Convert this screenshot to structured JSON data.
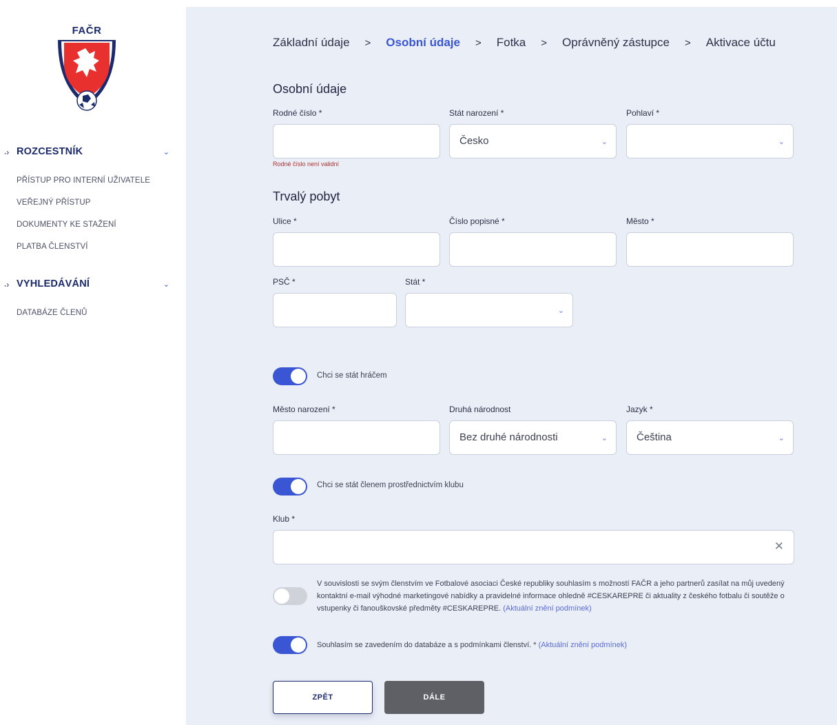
{
  "brand": {
    "logo_text": "FAČR"
  },
  "sidebar": {
    "sections": [
      {
        "title": "ROZCESTNÍK",
        "items": [
          "PŘÍSTUP PRO INTERNÍ UŽIVATELE",
          "VEŘEJNÝ PŘÍSTUP",
          "DOKUMENTY KE STAŽENÍ",
          "PLATBA ČLENSTVÍ"
        ]
      },
      {
        "title": "VYHLEDÁVÁNÍ",
        "items": [
          "DATABÁZE ČLENŮ"
        ]
      }
    ]
  },
  "breadcrumb": {
    "steps": [
      "Základní údaje",
      "Osobní údaje",
      "Fotka",
      "Oprávněný zástupce",
      "Aktivace účtu"
    ],
    "separator": ">",
    "active_index": 1
  },
  "personal": {
    "title": "Osobní údaje",
    "birth_number": {
      "label": "Rodné číslo *",
      "value": "",
      "error": "Rodné číslo není validní"
    },
    "birth_country": {
      "label": "Stát narození *",
      "value": "Česko"
    },
    "gender": {
      "label": "Pohlaví *",
      "value": ""
    }
  },
  "residence": {
    "title": "Trvalý pobyt",
    "street": {
      "label": "Ulice *",
      "value": ""
    },
    "house_number": {
      "label": "Číslo popisné *",
      "value": ""
    },
    "city": {
      "label": "Město *",
      "value": ""
    },
    "zip": {
      "label": "PSČ *",
      "value": ""
    },
    "country": {
      "label": "Stát *",
      "value": ""
    }
  },
  "player": {
    "toggle_label": "Chci se stát hráčem",
    "toggle_on": true,
    "birth_city": {
      "label": "Město narození *",
      "value": ""
    },
    "second_nationality": {
      "label": "Druhá národnost",
      "value": "Bez druhé národnosti"
    },
    "language": {
      "label": "Jazyk *",
      "value": "Čeština"
    }
  },
  "club_membership": {
    "toggle_label": "Chci se stát členem prostřednictvím klubu",
    "toggle_on": true,
    "club": {
      "label": "Klub *",
      "value": ""
    }
  },
  "marketing": {
    "toggle_on": false,
    "text": "V souvislosti se svým členstvím ve Fotbalové asociaci České republiky souhlasím s možností FAČR a jeho partnerů zasílat na můj uvedený kontaktní e-mail výhodné marketingové nabídky a pravidelné informace ohledně #CESKAREPRE či aktuality z českého fotbalu či soutěže o vstupenky či fanouškovské předměty #CESKAREPRE.",
    "link": "(Aktuální znění podmínek)"
  },
  "terms": {
    "toggle_on": true,
    "text": "Souhlasím se zavedením do databáze a s podmínkami členství. *",
    "link": "(Aktuální znění podmínek)"
  },
  "buttons": {
    "back": "ZPĚT",
    "next": "DÁLE"
  },
  "icons": {
    "dropdown": "chevron-down-icon",
    "clear": "close-icon",
    "breadcrumb_sep": "chevron-right-icon"
  },
  "colors": {
    "accent": "#3a56d4",
    "brand_navy": "#1b2a6b",
    "background": "#eaeef6",
    "error": "#b03030"
  }
}
